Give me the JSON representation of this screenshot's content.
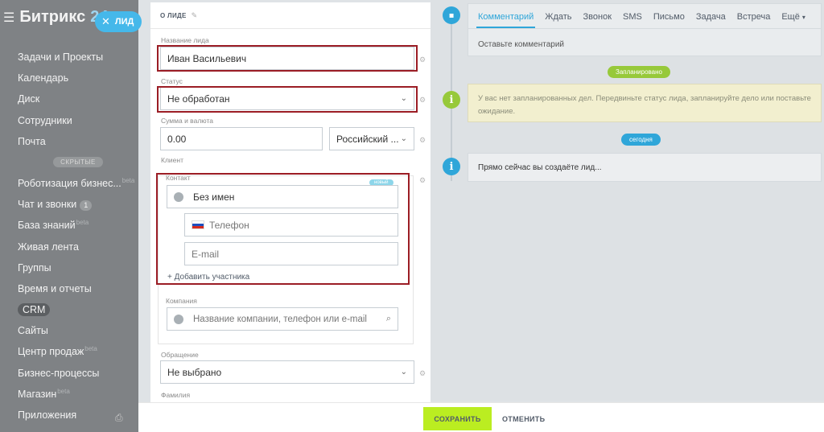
{
  "sidebar": {
    "brand_main": "Битрикс",
    "brand_num": "24",
    "lead_chip": "ЛИД",
    "items_top": [
      "Задачи и Проекты",
      "Календарь",
      "Диск",
      "Сотрудники",
      "Почта"
    ],
    "hidden_label": "СКРЫТЫЕ",
    "items_bottom": [
      {
        "label": "Роботизация бизнес...",
        "beta": "beta"
      },
      {
        "label": "Чат и звонки",
        "badge": "1"
      },
      {
        "label": "База знаний",
        "beta": "beta"
      },
      {
        "label": "Живая лента"
      },
      {
        "label": "Группы"
      },
      {
        "label": "Время и отчеты"
      },
      {
        "label": "CRM"
      },
      {
        "label": "Сайты"
      },
      {
        "label": "Центр продаж",
        "beta": "beta"
      },
      {
        "label": "Бизнес-процессы"
      },
      {
        "label": "Магазин",
        "beta": "beta"
      },
      {
        "label": "Приложения"
      }
    ]
  },
  "form": {
    "section_title": "О ЛИДЕ",
    "lead_name_label": "Название лида",
    "lead_name_value": "Иван Васильевич",
    "status_label": "Статус",
    "status_value": "Не обработан",
    "amount_label": "Сумма и валюта",
    "amount_value": "0.00",
    "currency_value": "Российский ...",
    "client_label": "Клиент",
    "contact_label": "Контакт",
    "new_tag": "новый",
    "contact_name_value": "Без имен",
    "phone_placeholder": "Телефон",
    "email_placeholder": "E-mail",
    "add_participant": "+ Добавить участника",
    "company_label": "Компания",
    "company_placeholder": "Название компании, телефон или e-mail",
    "salutation_label": "Обращение",
    "salutation_value": "Не выбрано",
    "surname_label": "Фамилия"
  },
  "timeline": {
    "tabs": [
      "Комментарий",
      "Ждать",
      "Звонок",
      "SMS",
      "Письмо",
      "Задача",
      "Встреча",
      "Ещё"
    ],
    "comment_placeholder": "Оставьте комментарий",
    "planned_pill": "Запланировано",
    "planned_text": "У вас нет запланированных дел. Передвиньте статус лида, запланируйте дело или поставьте ожидание.",
    "today_pill": "сегодня",
    "now_text": "Прямо сейчас вы создаёте лид..."
  },
  "footer": {
    "save": "СОХРАНИТЬ",
    "cancel": "ОТМЕНИТЬ"
  }
}
